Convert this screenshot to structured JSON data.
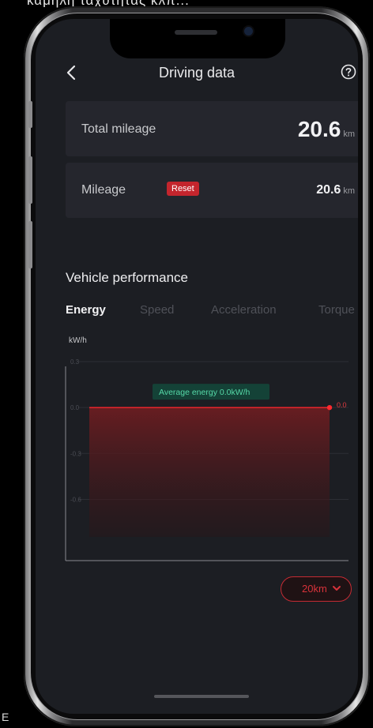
{
  "caption": "καμηλή ταχύτητας κλπ...",
  "corner_glyph": "E",
  "header": {
    "title": "Driving data",
    "back_icon": "chevron-left-icon",
    "help_icon": "help-circle-icon"
  },
  "total_mileage": {
    "label": "Total mileage",
    "value": "20.6",
    "unit": "km"
  },
  "mileage": {
    "label": "Mileage",
    "reset_label": "Reset",
    "value": "20.6",
    "unit": "km"
  },
  "performance": {
    "title": "Vehicle performance",
    "tabs": [
      "Energy",
      "Speed",
      "Acceleration",
      "Torque"
    ],
    "active_tab": "Energy"
  },
  "chart_data": {
    "type": "area",
    "ylabel": "kW/h",
    "y_ticks": [
      "0.3",
      "0.0",
      "-0.3",
      "-0.6"
    ],
    "y_tick_values": [
      0.3,
      0.0,
      -0.3,
      -0.6
    ],
    "ylim": [
      -1.0,
      0.3
    ],
    "series": [
      {
        "values": [
          0.0,
          0.0
        ]
      }
    ],
    "end_label": "0.0",
    "average_label": "Average energy 0.0kW/h",
    "line_color": "#e0252b",
    "fill_color": "#5a1c1f"
  },
  "range_selector": {
    "value": "20km",
    "icon": "chevron-down-icon"
  },
  "colors": {
    "accent": "#c4252d",
    "background": "#1c1e23",
    "card": "#25262d"
  }
}
